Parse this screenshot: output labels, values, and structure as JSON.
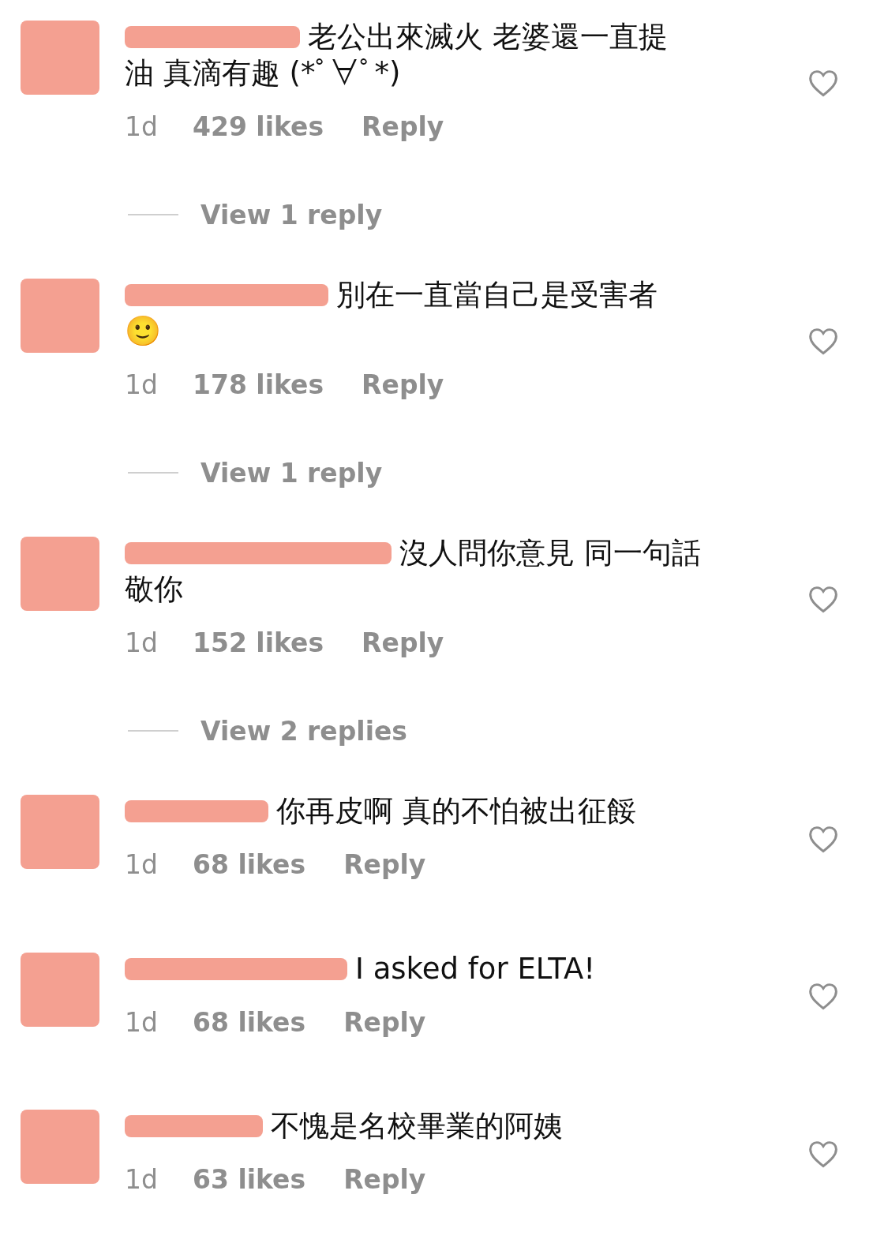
{
  "comments": [
    {
      "lines": [
        "老公出來滅火 老婆還一直提",
        "油 真滴有趣 (*ﾟ∀ﾟ*)"
      ],
      "time": "1d",
      "likes": "429 likes",
      "reply": "Reply",
      "view_replies": "View 1 reply"
    },
    {
      "lines": [
        "別在一直當自己是受害者",
        "🙂"
      ],
      "time": "1d",
      "likes": "178 likes",
      "reply": "Reply",
      "view_replies": "View 1 reply"
    },
    {
      "lines": [
        "沒人問你意見 同一句話",
        "敬你"
      ],
      "time": "1d",
      "likes": "152 likes",
      "reply": "Reply",
      "view_replies": "View 2 replies"
    },
    {
      "lines": [
        "你再皮啊 真的不怕被出征餒"
      ],
      "time": "1d",
      "likes": "68 likes",
      "reply": "Reply"
    },
    {
      "lines": [
        "I asked for ELTA!"
      ],
      "time": "1d",
      "likes": "68 likes",
      "reply": "Reply"
    },
    {
      "lines": [
        "不愧是名校畢業的阿姨"
      ],
      "time": "1d",
      "likes": "63 likes",
      "reply": "Reply"
    }
  ]
}
